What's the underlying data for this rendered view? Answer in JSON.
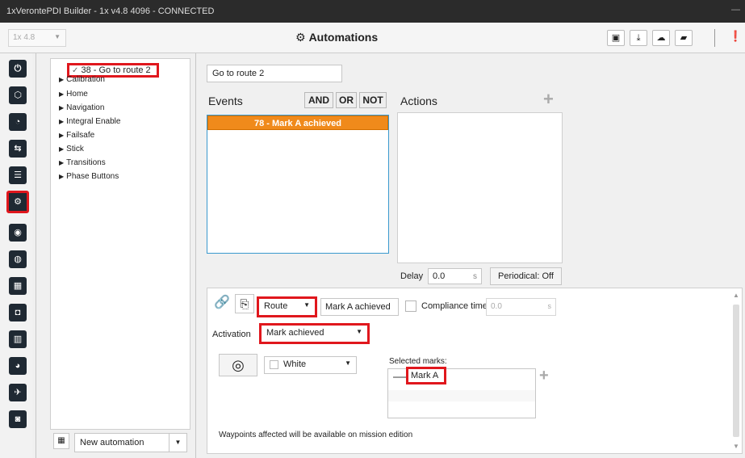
{
  "window": {
    "title": "1xVerontePDI Builder - 1x v4.8 4096 - CONNECTED",
    "minimize": "—"
  },
  "toolbar": {
    "version": "1x 4.8",
    "page_title": "Automations",
    "info_glyph": "❗"
  },
  "sidebar_icons": [
    "power-icon",
    "grid-icon",
    "rss-icon",
    "usb-icon",
    "sliders-icon",
    "gears-icon",
    "antenna-icon",
    "gamepad-icon",
    "apps-icon",
    "camera-icon",
    "chart-icon",
    "dashboard-icon",
    "plane-icon",
    "shield-icon"
  ],
  "tree": {
    "selected": "38 - Go to route 2",
    "items": [
      "Calibration",
      "Home",
      "Navigation",
      "Integral Enable",
      "Failsafe",
      "Stick",
      "Transitions",
      "Phase Buttons"
    ]
  },
  "tree_footer": {
    "new_automation": "New automation"
  },
  "automation": {
    "name": "Go to route 2",
    "events_label": "Events",
    "and_label": "AND",
    "or_label": "OR",
    "not_label": "NOT",
    "event_item": "78 - Mark A achieved",
    "actions_label": "Actions",
    "add": "+",
    "delay_label": "Delay",
    "delay_value": "0.0",
    "delay_unit": "s",
    "periodical": "Periodical: Off"
  },
  "event_config": {
    "type": "Route",
    "mark_field": "Mark A achieved",
    "compliance_label": "Compliance time",
    "compliance_value": "0.0",
    "compliance_unit": "s",
    "activation_label": "Activation",
    "activation_value": "Mark achieved",
    "color_value": "White",
    "selected_marks_label": "Selected marks:",
    "selected_mark": "Mark A",
    "footnote": "Waypoints affected will be available on mission edition"
  },
  "colors": {
    "accent_red": "#e0171d",
    "event_orange": "#f08a1b",
    "icon_dark": "#1f2933",
    "focus_blue": "#3a99ce"
  }
}
